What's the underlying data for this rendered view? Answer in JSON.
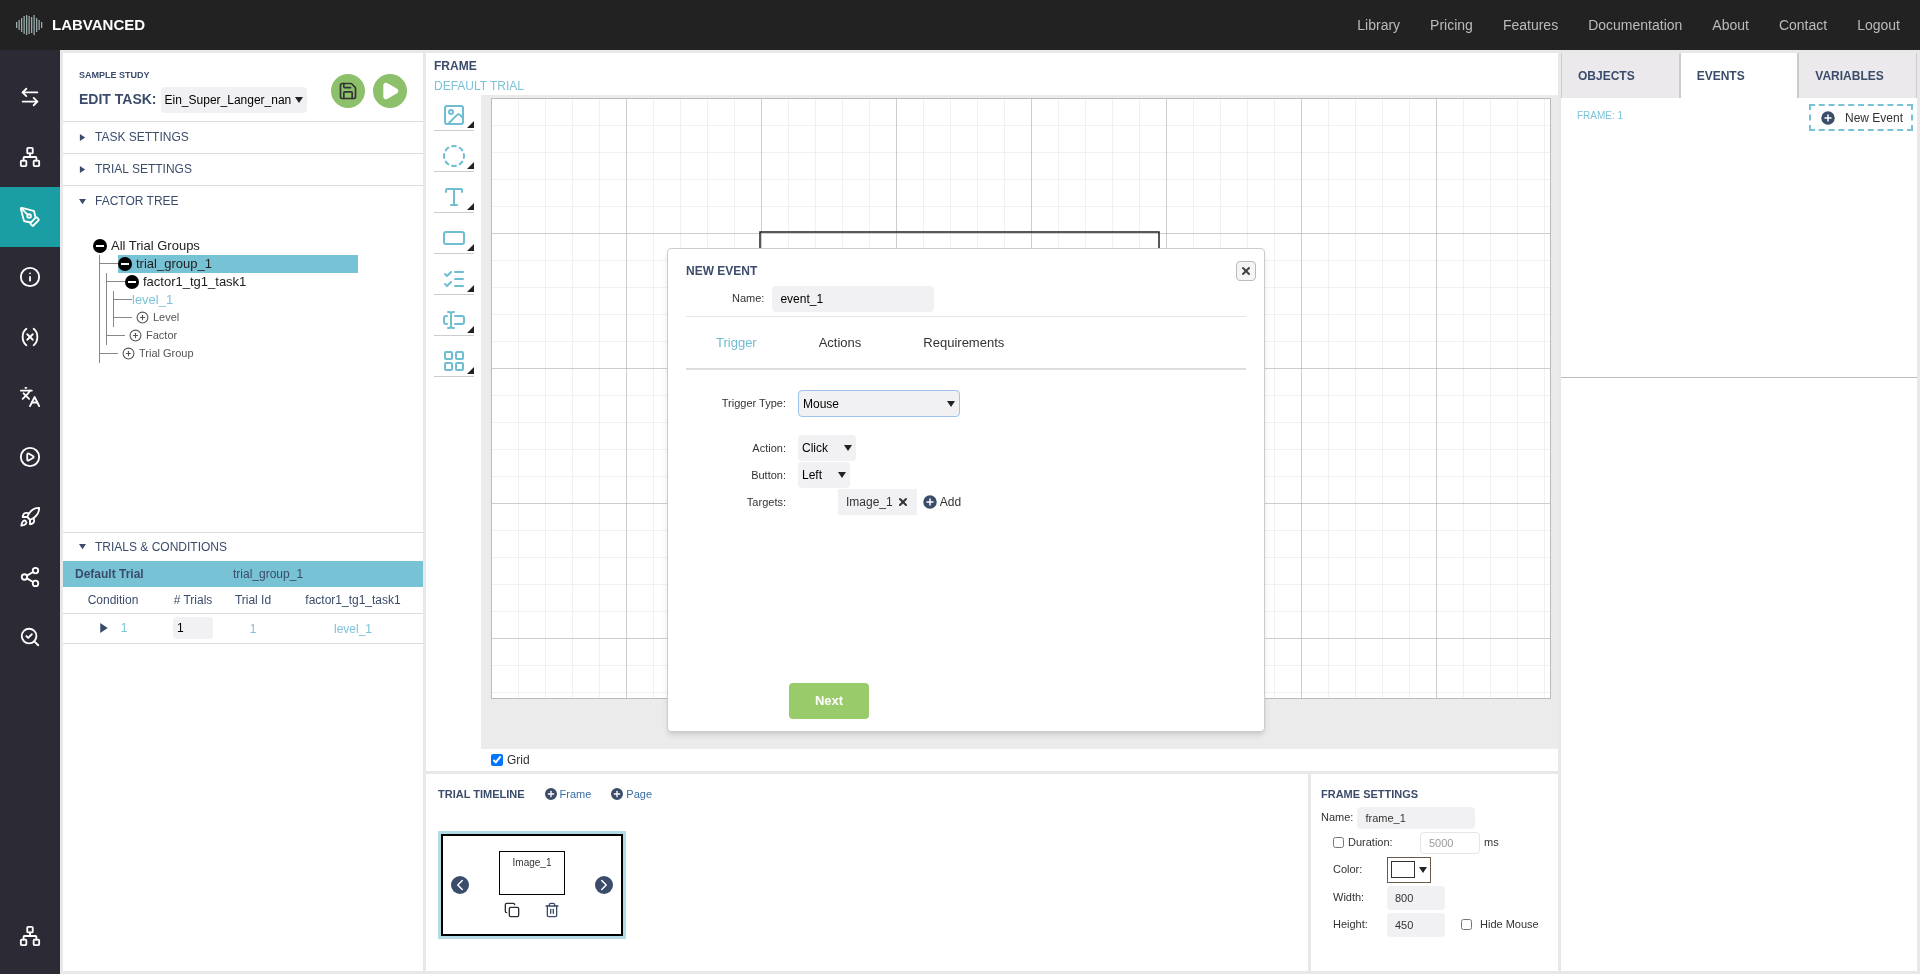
{
  "nav": {
    "logo": "LABVANCED",
    "links": [
      "Library",
      "Pricing",
      "Features",
      "Documentation",
      "About",
      "Contact",
      "Logout"
    ]
  },
  "sidebar": {
    "items": [
      {
        "kind": "swap",
        "selected": false
      },
      {
        "kind": "tree",
        "selected": false
      },
      {
        "kind": "pen",
        "selected": true
      },
      {
        "kind": "info",
        "selected": false
      },
      {
        "kind": "variable",
        "selected": false
      },
      {
        "kind": "translate",
        "selected": false
      },
      {
        "kind": "play",
        "selected": false
      },
      {
        "kind": "rocket",
        "selected": false
      },
      {
        "kind": "share",
        "selected": false
      },
      {
        "kind": "search",
        "selected": false
      }
    ],
    "bottom": {
      "kind": "tree",
      "selected": false
    }
  },
  "task_panel": {
    "study": "SAMPLE STUDY",
    "edit_label": "EDIT TASK:",
    "task": "Ein_Super_Langer_nan",
    "sections": [
      {
        "title": "TASK SETTINGS",
        "expanded": false
      },
      {
        "title": "TRIAL SETTINGS",
        "expanded": false
      },
      {
        "title": "FACTOR TREE",
        "expanded": true
      }
    ],
    "factor_tree": {
      "kind": "node",
      "label": "All Trial Groups",
      "selected": false,
      "children": [
        {
          "kind": "node",
          "label": "trial_group_1",
          "selected": true,
          "children": [
            {
              "kind": "node",
              "label": "factor1_tg1_task1",
              "selected": false,
              "children": [
                {
                  "kind": "leaf",
                  "label": "level_1"
                },
                {
                  "kind": "add",
                  "label": "Level"
                }
              ]
            },
            {
              "kind": "add",
              "label": "Factor"
            }
          ]
        },
        {
          "kind": "add",
          "label": "Trial Group"
        }
      ]
    }
  },
  "trials": {
    "title": "TRIALS & CONDITIONS",
    "expanded": true,
    "trial_name": "Default Trial",
    "group": "trial_group_1",
    "columns": [
      "Condition",
      "# Trials",
      "Trial Id",
      "factor1_tg1_task1"
    ],
    "rows": [
      {
        "condition": "1",
        "trials": "1",
        "trial_id": "1",
        "level": "level_1"
      }
    ]
  },
  "frame": {
    "title": "FRAME",
    "subtitle": "DEFAULT TRIAL",
    "tools": [
      {
        "kind": "image"
      },
      {
        "kind": "shape"
      },
      {
        "kind": "text"
      },
      {
        "kind": "button"
      },
      {
        "kind": "list"
      },
      {
        "kind": "input"
      },
      {
        "kind": "grid"
      }
    ],
    "grid": {
      "label": "Grid",
      "checked": true
    }
  },
  "dialog": {
    "title": "NEW EVENT",
    "name_label": "Name:",
    "name_value": "event_1",
    "tabs": [
      {
        "label": "Trigger",
        "selected": true
      },
      {
        "label": "Actions",
        "selected": false
      },
      {
        "label": "Requirements",
        "selected": false
      }
    ],
    "trigger_type": {
      "label": "Trigger Type:",
      "value": "Mouse"
    },
    "fields": [
      {
        "label": "Action:",
        "value": "Click"
      },
      {
        "label": "Button:",
        "value": "Left"
      }
    ],
    "targets": {
      "label": "Targets:",
      "items": [
        "Image_1"
      ],
      "add": "Add"
    },
    "next": "Next"
  },
  "right_panel": {
    "tabs": [
      {
        "label": "OBJECTS",
        "selected": false
      },
      {
        "label": "EVENTS",
        "selected": true
      },
      {
        "label": "VARIABLES",
        "selected": false
      }
    ],
    "frame_label": "FRAME: 1",
    "new_event": "New Event"
  },
  "timeline": {
    "title": "TRIAL TIMELINE",
    "add_buttons": [
      "Frame",
      "Page"
    ],
    "frames": [
      {
        "label": "Image_1",
        "selected": true
      }
    ]
  },
  "frame_settings": {
    "title": "FRAME SETTINGS",
    "name": {
      "label": "Name:",
      "value": "frame_1"
    },
    "duration": {
      "label": "Duration:",
      "placeholder": "5000",
      "unit": "ms",
      "checked": false
    },
    "color": {
      "label": "Color:",
      "color": "#ffffff"
    },
    "width": {
      "label": "Width:",
      "value": "800"
    },
    "height": {
      "label": "Height:",
      "value": "450"
    },
    "hide_mouse": {
      "label": "Hide Mouse",
      "checked": false
    }
  }
}
